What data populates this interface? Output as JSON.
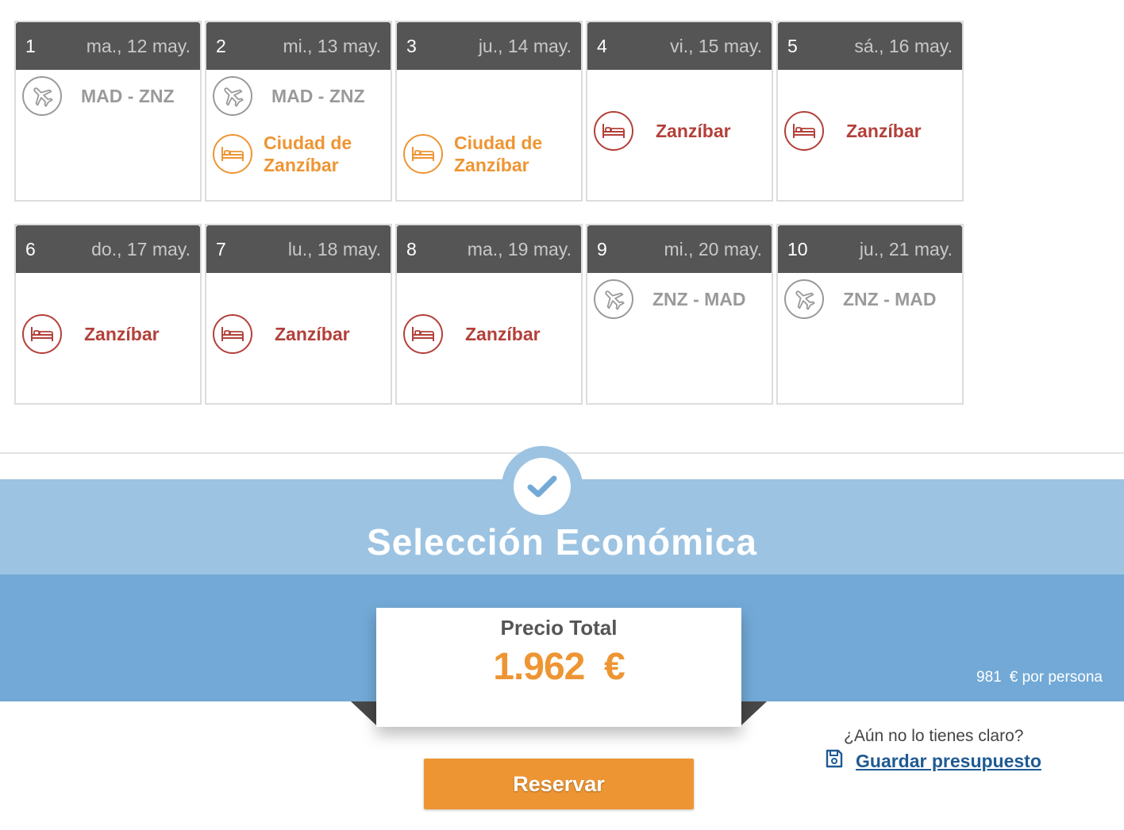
{
  "itinerary": {
    "row1": [
      {
        "num": "1",
        "date": "ma., 12 may.",
        "flight": "MAD - ZNZ",
        "hotel": ""
      },
      {
        "num": "2",
        "date": "mi., 13 may.",
        "flight": "MAD - ZNZ",
        "hotel": "Ciudad de Zanzíbar"
      },
      {
        "num": "3",
        "date": "ju., 14 may.",
        "flight": "",
        "hotel": "Ciudad de Zanzíbar"
      },
      {
        "num": "4",
        "date": "vi., 15 may.",
        "flight": "",
        "hotel": "Zanzíbar"
      },
      {
        "num": "5",
        "date": "sá., 16 may.",
        "flight": "",
        "hotel": "Zanzíbar"
      }
    ],
    "row2": [
      {
        "num": "6",
        "date": "do., 17 may.",
        "flight": "",
        "hotel": "Zanzíbar"
      },
      {
        "num": "7",
        "date": "lu., 18 may.",
        "flight": "",
        "hotel": "Zanzíbar"
      },
      {
        "num": "8",
        "date": "ma., 19 may.",
        "flight": "",
        "hotel": "Zanzíbar"
      },
      {
        "num": "9",
        "date": "mi., 20 may.",
        "flight": "ZNZ - MAD",
        "hotel": ""
      },
      {
        "num": "10",
        "date": "ju., 21 may.",
        "flight": "ZNZ - MAD",
        "hotel": ""
      }
    ]
  },
  "icons": {
    "flight": "airplane-icon",
    "hotel": "bed-icon",
    "check": "check-icon",
    "save": "floppy-disk-icon"
  },
  "colors": {
    "header": "#555555",
    "flight": "#9a9a9a",
    "hotel_city": "#ee9533",
    "hotel_beach": "#b3403a",
    "accent": "#ee9533",
    "band_light": "#9cc3e2",
    "band_dark": "#72a9d6",
    "link": "#1f5a93"
  },
  "summary": {
    "title": "Selección Económica",
    "price_label": "Precio Total",
    "price_value": "1.962  €",
    "per_person_amount": "981",
    "per_person_label": "€ por persona",
    "reserve_label": "Reservar",
    "unsure_text": "¿Aún no lo tienes claro?",
    "save_label": "Guardar presupuesto"
  }
}
